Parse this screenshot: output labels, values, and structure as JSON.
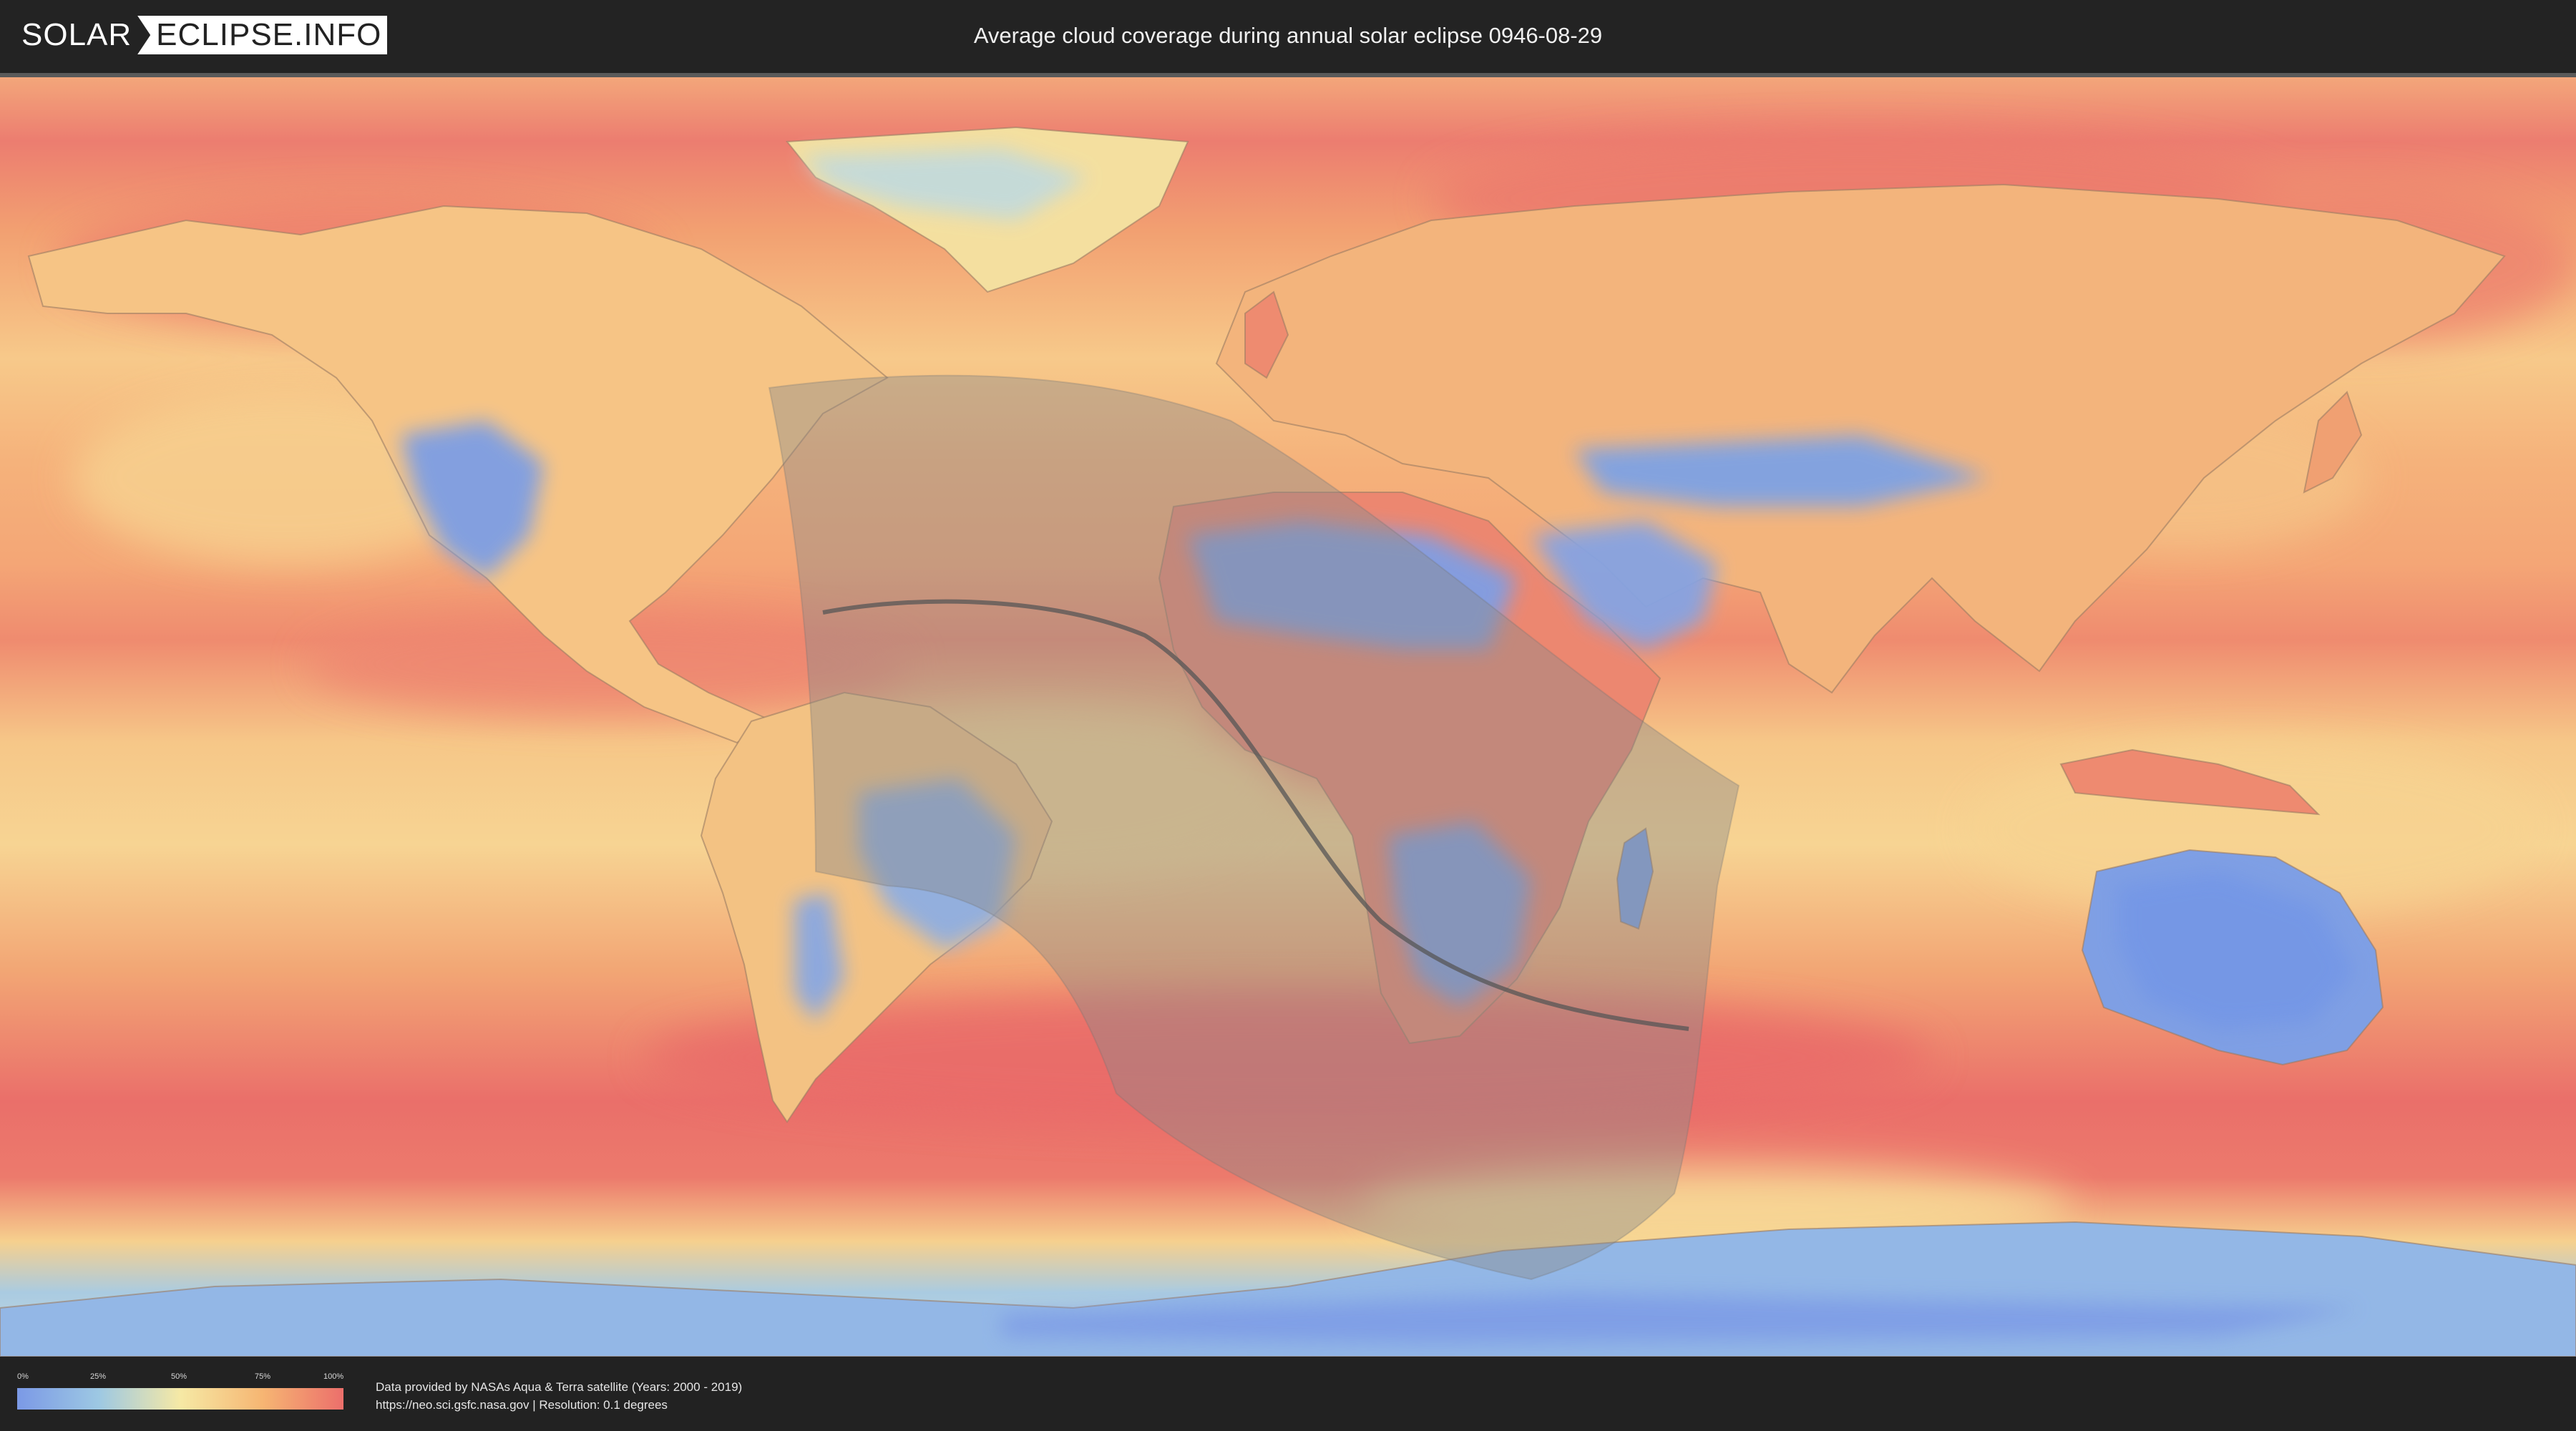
{
  "header": {
    "logo_left": "SOLAR",
    "logo_right": "ECLIPSE.INFO",
    "title": "Average cloud coverage during annual solar eclipse 0946-08-29"
  },
  "map": {
    "layer": "average cloud coverage",
    "eclipse_type": "annular",
    "shadow_color": "#8a8a8a",
    "central_line_color": "#555555"
  },
  "legend": {
    "ticks": [
      "0%",
      "25%",
      "50%",
      "75%",
      "100%"
    ],
    "colors": [
      "#7b99e6",
      "#9dc8e3",
      "#f6e9a5",
      "#f6b673",
      "#ec6f6b"
    ]
  },
  "footer": {
    "line1": "Data provided by NASAs Aqua & Terra satellite (Years: 2000 - 2019)",
    "line2": "https://neo.sci.gsfc.nasa.gov | Resolution: 0.1 degrees"
  }
}
